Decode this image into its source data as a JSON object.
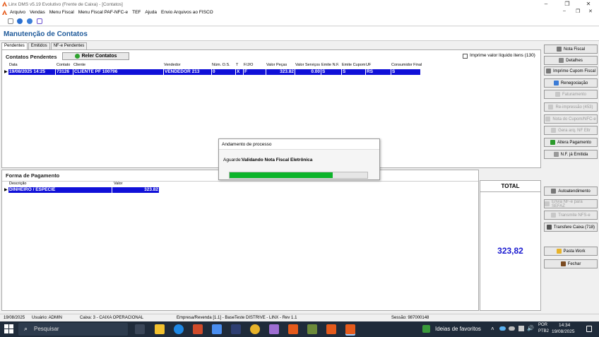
{
  "window": {
    "title": "Linx DMS v5.19 Evolutivo (Frente de Caixa) - [Contatos]",
    "min": "–",
    "max": "❐",
    "close": "✕"
  },
  "menu": [
    "Arquivo",
    "Vendas",
    "Menu Fiscal",
    "Menu Fiscal PAF-NFC-e",
    "TEF",
    "Ajuda",
    "Envio Arquivos ao FISCO"
  ],
  "child_controls": {
    "min": "–",
    "restore": "❐",
    "close": "✕"
  },
  "page_title": "Manutenção de Contatos",
  "tabs": [
    "Pendentes",
    "Emitidos",
    "NF-e Pendentes"
  ],
  "contatos": {
    "title": "Contatos Pendentes",
    "reload_label": "Reler Contatos",
    "checkbox_label": "Imprime valor líquido itens (130)",
    "columns": [
      "Data",
      "Contato",
      "Cliente",
      "Vendedor",
      "Núm. O.S.",
      "T",
      "F/J/O",
      "Valor Peças",
      "Valor Serviços",
      "Emite N.F.",
      "Emite Cupom",
      "UF",
      "Consumidor Final"
    ],
    "row": [
      "19/08/2025 14:25",
      "73126",
      "CLIENTE PF 100796",
      "VENDEDOR 213",
      "0",
      "X",
      "F",
      "323.82",
      "0.00",
      "S",
      "S",
      "RS",
      "S"
    ]
  },
  "pagamento": {
    "title": "Forma de Pagamento",
    "columns": [
      "Descrição",
      "Valor"
    ],
    "row": [
      "DINHEIRO / ESPECIE",
      "323.82"
    ],
    "total_label": "TOTAL",
    "total_value": "323,82"
  },
  "dialog": {
    "title": "Andamento de processo",
    "label_prefix": "Aguarde:",
    "label_text": "Validando Nota Fiscal Eletrônica",
    "progress": 0.75,
    "progress_color": "#0cb42a"
  },
  "side_buttons": [
    {
      "label": "Nota Fiscal",
      "enabled": true,
      "icon": "printer-icon"
    },
    {
      "label": "Detalhes",
      "enabled": true,
      "icon": "magnifier-icon"
    },
    {
      "label": "Imprime Cupom Fiscal",
      "enabled": true,
      "icon": "printer-icon"
    },
    {
      "label": "Renegociação",
      "enabled": true,
      "icon": "renegotiate-icon"
    },
    {
      "label": "Faturamento",
      "enabled": false,
      "icon": "invoice-icon"
    },
    {
      "label": "Re-impressão (453)",
      "enabled": false,
      "icon": "printer-icon"
    },
    {
      "label": "Nota do Cupom/NFC-e",
      "enabled": false,
      "icon": "document-icon"
    },
    {
      "label": "Gera arq. NF Eltr",
      "enabled": false,
      "icon": "file-icon"
    },
    {
      "label": "Altera Pagamento",
      "enabled": true,
      "icon": "dollar-icon"
    },
    {
      "label": "N.F. já Emitida",
      "enabled": true,
      "icon": "document-icon"
    },
    {
      "label": "Autoatendimento",
      "enabled": true,
      "icon": "printer-icon"
    },
    {
      "label": "Envia NF-e para SEFAZ",
      "enabled": false,
      "icon": "send-icon"
    },
    {
      "label": "Transmite NFS-e",
      "enabled": false,
      "icon": "send-icon"
    },
    {
      "label": "Transfere Caixa (718)",
      "enabled": true,
      "icon": "transfer-icon"
    },
    {
      "label": "Pasta Work",
      "enabled": true,
      "icon": "folder-icon"
    },
    {
      "label": "Fechar",
      "enabled": true,
      "icon": "door-icon"
    }
  ],
  "status": {
    "date": "19/08/2025",
    "user": "Usuário: ADMIN",
    "caixa": "Caixa: 3 - CAIXA OPERACIONAL",
    "empresa": "Empresa/Revenda [1.1] - BaseTeste DISTRIVE - LINX - Rev 1.1",
    "sessao": "Sessão: 987000148"
  },
  "taskbar": {
    "search_placeholder": "Pesquisar",
    "news": "Ideias de favoritos",
    "lang1": "POR",
    "lang2": "PTB2",
    "time": "14:34",
    "date": "19/08/2025"
  },
  "colors": {
    "selection": "#1010d8",
    "title_blue": "#1f5a9a",
    "total_blue": "#1a1ad0",
    "brand": "#e55a1b"
  }
}
